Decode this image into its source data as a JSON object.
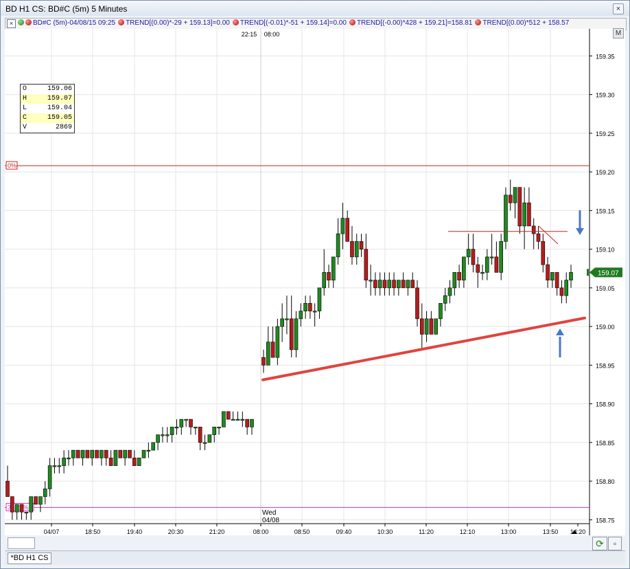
{
  "window": {
    "title": "BD H1 CS: BD#C (5m) 5 Minutes",
    "close_glyph": "×"
  },
  "study_bar": {
    "close_glyph": "×",
    "items": [
      {
        "icon": "green-red-dot-pair",
        "text": "BD#C (5m)-04/08/15 09:25"
      },
      {
        "icon": "red-dot",
        "text": "TREND[(0.00)*-29 + 159.13]=0.00"
      },
      {
        "icon": "red-dot",
        "text": "TREND[(-0.01)*-51 + 159.14]=0.00"
      },
      {
        "icon": "red-dot",
        "text": "TREND[(-0.00)*428 + 159.21]=158.81"
      },
      {
        "icon": "red-dot",
        "text": "TREND[(0.00)*512 + 158.57"
      }
    ],
    "m_button": "M"
  },
  "ohlc_box": {
    "rows": [
      {
        "label": "O",
        "value": "159.06",
        "highlight": false
      },
      {
        "label": "H",
        "value": "159.07",
        "highlight": true
      },
      {
        "label": "L",
        "value": "159.04",
        "highlight": false
      },
      {
        "label": "C",
        "value": "159.05",
        "highlight": true
      },
      {
        "label": "V",
        "value": "2869",
        "highlight": false
      }
    ]
  },
  "chart_data": {
    "type": "candlestick",
    "symbol": "BD#C",
    "interval": "5 Minutes",
    "y_axis": {
      "ticks": [
        "159.35",
        "159.30",
        "159.25",
        "159.20",
        "159.15",
        "159.10",
        "159.05",
        "159.00",
        "158.95",
        "158.90",
        "158.85",
        "158.80",
        "158.75"
      ],
      "range": [
        158.745,
        159.385
      ]
    },
    "x_axis": {
      "ticks": [
        "04/07",
        "18:50",
        "19:40",
        "20:30",
        "21:20",
        "08:00",
        "08:50",
        "09:40",
        "10:30",
        "11:20",
        "12:10",
        "13:00",
        "13:50",
        "14:20"
      ],
      "top_labels": [
        "22:15",
        "08:00"
      ],
      "session_label": [
        "Wed",
        "04/08"
      ]
    },
    "last_price_label": "159.07",
    "horizontal_levels": [
      {
        "label": "0%",
        "value": 159.208,
        "color": "#cc2222"
      },
      {
        "label": "38.20%",
        "value": 158.766,
        "color": "#cc33cc"
      }
    ],
    "trendlines": [
      {
        "from": [
          0,
          158.931
        ],
        "to": [
          1,
          159.011
        ],
        "color": "#e0443e",
        "note": "support line drawn from session open to latest bar"
      },
      {
        "from": [
          0,
          159.123
        ],
        "to": [
          1,
          159.123
        ],
        "color": "#cc2222",
        "note": "short horizontal resistance line"
      }
    ],
    "annotations": [
      {
        "kind": "arrow-down",
        "color": "#4a78c8"
      },
      {
        "kind": "arrow-up",
        "color": "#4a78c8"
      }
    ],
    "candles": [
      [
        158.8,
        158.82,
        158.78,
        158.78
      ],
      [
        158.78,
        158.78,
        158.75,
        158.76
      ],
      [
        158.76,
        158.77,
        158.75,
        158.77
      ],
      [
        158.77,
        158.77,
        158.75,
        158.76
      ],
      [
        158.76,
        158.76,
        158.75,
        158.76
      ],
      [
        158.76,
        158.78,
        158.75,
        158.78
      ],
      [
        158.78,
        158.78,
        158.77,
        158.77
      ],
      [
        158.77,
        158.78,
        158.76,
        158.78
      ],
      [
        158.78,
        158.8,
        158.77,
        158.79
      ],
      [
        158.79,
        158.83,
        158.78,
        158.82
      ],
      [
        158.82,
        158.83,
        158.81,
        158.82
      ],
      [
        158.82,
        158.83,
        158.81,
        158.82
      ],
      [
        158.82,
        158.84,
        158.81,
        158.83
      ],
      [
        158.83,
        158.84,
        158.82,
        158.83
      ],
      [
        158.83,
        158.84,
        158.82,
        158.84
      ],
      [
        158.84,
        158.84,
        158.83,
        158.83
      ],
      [
        158.83,
        158.84,
        158.82,
        158.84
      ],
      [
        158.84,
        158.84,
        158.83,
        158.83
      ],
      [
        158.83,
        158.84,
        158.82,
        158.84
      ],
      [
        158.84,
        158.84,
        158.83,
        158.83
      ],
      [
        158.83,
        158.84,
        158.82,
        158.84
      ],
      [
        158.84,
        158.84,
        158.82,
        158.83
      ],
      [
        158.83,
        158.84,
        158.82,
        158.82
      ],
      [
        158.82,
        158.84,
        158.82,
        158.84
      ],
      [
        158.84,
        158.84,
        158.83,
        158.83
      ],
      [
        158.83,
        158.84,
        158.82,
        158.84
      ],
      [
        158.84,
        158.84,
        158.83,
        158.83
      ],
      [
        158.83,
        158.84,
        158.82,
        158.82
      ],
      [
        158.82,
        158.83,
        158.82,
        158.83
      ],
      [
        158.83,
        158.84,
        158.83,
        158.84
      ],
      [
        158.84,
        158.85,
        158.83,
        158.84
      ],
      [
        158.84,
        158.85,
        158.84,
        158.85
      ],
      [
        158.85,
        158.86,
        158.84,
        158.86
      ],
      [
        158.86,
        158.87,
        158.85,
        158.86
      ],
      [
        158.86,
        158.87,
        158.85,
        158.86
      ],
      [
        158.86,
        158.87,
        158.85,
        158.87
      ],
      [
        158.87,
        158.88,
        158.86,
        158.87
      ],
      [
        158.87,
        158.88,
        158.86,
        158.88
      ],
      [
        158.88,
        158.88,
        158.87,
        158.88
      ],
      [
        158.88,
        158.88,
        158.86,
        158.87
      ],
      [
        158.87,
        158.87,
        158.86,
        158.87
      ],
      [
        158.87,
        158.87,
        158.84,
        158.85
      ],
      [
        158.85,
        158.86,
        158.84,
        158.85
      ],
      [
        158.85,
        158.86,
        158.85,
        158.86
      ],
      [
        158.86,
        158.87,
        158.85,
        158.87
      ],
      [
        158.87,
        158.87,
        158.86,
        158.87
      ],
      [
        158.87,
        158.89,
        158.87,
        158.89
      ],
      [
        158.89,
        158.89,
        158.88,
        158.88
      ],
      [
        158.88,
        158.89,
        158.88,
        158.88
      ],
      [
        158.88,
        158.89,
        158.88,
        158.88
      ],
      [
        158.88,
        158.89,
        158.87,
        158.88
      ],
      [
        158.88,
        158.88,
        158.86,
        158.87
      ],
      [
        158.87,
        158.88,
        158.86,
        158.88
      ],
      [
        158.96,
        158.97,
        158.94,
        158.95
      ],
      [
        158.95,
        159.0,
        158.95,
        158.98
      ],
      [
        158.98,
        159.0,
        158.96,
        158.96
      ],
      [
        158.96,
        159.01,
        158.95,
        159.0
      ],
      [
        159.0,
        159.03,
        158.98,
        159.01
      ],
      [
        159.01,
        159.04,
        158.99,
        159.01
      ],
      [
        159.01,
        159.04,
        158.96,
        158.97
      ],
      [
        158.97,
        159.02,
        158.96,
        159.01
      ],
      [
        159.01,
        159.03,
        159.0,
        159.02
      ],
      [
        159.02,
        159.04,
        159.01,
        159.03
      ],
      [
        159.03,
        159.04,
        159.01,
        159.02
      ],
      [
        159.02,
        159.03,
        159.0,
        159.02
      ],
      [
        159.02,
        159.05,
        159.01,
        159.05
      ],
      [
        159.05,
        159.1,
        159.04,
        159.07
      ],
      [
        159.07,
        159.08,
        159.05,
        159.06
      ],
      [
        159.06,
        159.09,
        159.05,
        159.09
      ],
      [
        159.09,
        159.14,
        159.08,
        159.12
      ],
      [
        159.12,
        159.16,
        159.1,
        159.14
      ],
      [
        159.14,
        159.15,
        159.11,
        159.11
      ],
      [
        159.11,
        159.13,
        159.08,
        159.09
      ],
      [
        159.09,
        159.12,
        159.08,
        159.11
      ],
      [
        159.11,
        159.12,
        159.09,
        159.1
      ],
      [
        159.1,
        159.12,
        159.05,
        159.06
      ],
      [
        159.06,
        159.08,
        159.04,
        159.06
      ],
      [
        159.06,
        159.07,
        159.04,
        159.05
      ],
      [
        159.05,
        159.07,
        159.04,
        159.06
      ],
      [
        159.06,
        159.07,
        159.04,
        159.05
      ],
      [
        159.05,
        159.07,
        159.04,
        159.06
      ],
      [
        159.06,
        159.07,
        159.04,
        159.05
      ],
      [
        159.05,
        159.06,
        159.04,
        159.06
      ],
      [
        159.06,
        159.07,
        159.05,
        159.05
      ],
      [
        159.05,
        159.06,
        159.04,
        159.06
      ],
      [
        159.06,
        159.07,
        159.05,
        159.05
      ],
      [
        159.05,
        159.06,
        159.0,
        159.01
      ],
      [
        159.01,
        159.03,
        158.97,
        158.99
      ],
      [
        158.99,
        159.02,
        158.98,
        159.01
      ],
      [
        159.01,
        159.02,
        158.99,
        158.99
      ],
      [
        158.99,
        159.01,
        158.99,
        159.01
      ],
      [
        159.01,
        159.03,
        159.0,
        159.03
      ],
      [
        159.03,
        159.05,
        159.02,
        159.04
      ],
      [
        159.04,
        159.06,
        159.03,
        159.05
      ],
      [
        159.05,
        159.07,
        159.04,
        159.07
      ],
      [
        159.07,
        159.08,
        159.05,
        159.06
      ],
      [
        159.06,
        159.09,
        159.05,
        159.09
      ],
      [
        159.09,
        159.12,
        159.08,
        159.1
      ],
      [
        159.1,
        159.12,
        159.07,
        159.08
      ],
      [
        159.08,
        159.09,
        159.05,
        159.07
      ],
      [
        159.07,
        159.08,
        159.06,
        159.07
      ],
      [
        159.07,
        159.1,
        159.06,
        159.09
      ],
      [
        159.09,
        159.12,
        159.08,
        159.09
      ],
      [
        159.09,
        159.11,
        159.07,
        159.07
      ],
      [
        159.07,
        159.12,
        159.06,
        159.11
      ],
      [
        159.11,
        159.18,
        159.1,
        159.17
      ],
      [
        159.17,
        159.19,
        159.15,
        159.16
      ],
      [
        159.16,
        159.18,
        159.14,
        159.18
      ],
      [
        159.18,
        159.18,
        159.12,
        159.13
      ],
      [
        159.13,
        159.18,
        159.1,
        159.16
      ],
      [
        159.16,
        159.18,
        159.13,
        159.13
      ],
      [
        159.13,
        159.14,
        159.1,
        159.12
      ],
      [
        159.12,
        159.13,
        159.1,
        159.11
      ],
      [
        159.11,
        159.12,
        159.07,
        159.08
      ],
      [
        159.08,
        159.09,
        159.05,
        159.06
      ],
      [
        159.06,
        159.07,
        159.05,
        159.07
      ],
      [
        159.07,
        159.07,
        159.04,
        159.05
      ],
      [
        159.05,
        159.06,
        159.03,
        159.04
      ],
      [
        159.04,
        159.07,
        159.03,
        159.06
      ],
      [
        159.06,
        159.08,
        159.05,
        159.07
      ]
    ]
  },
  "bottom": {
    "refresh_glyph": "⟳",
    "restore_glyph": "▫",
    "tab_label": "*BD H1 CS"
  }
}
